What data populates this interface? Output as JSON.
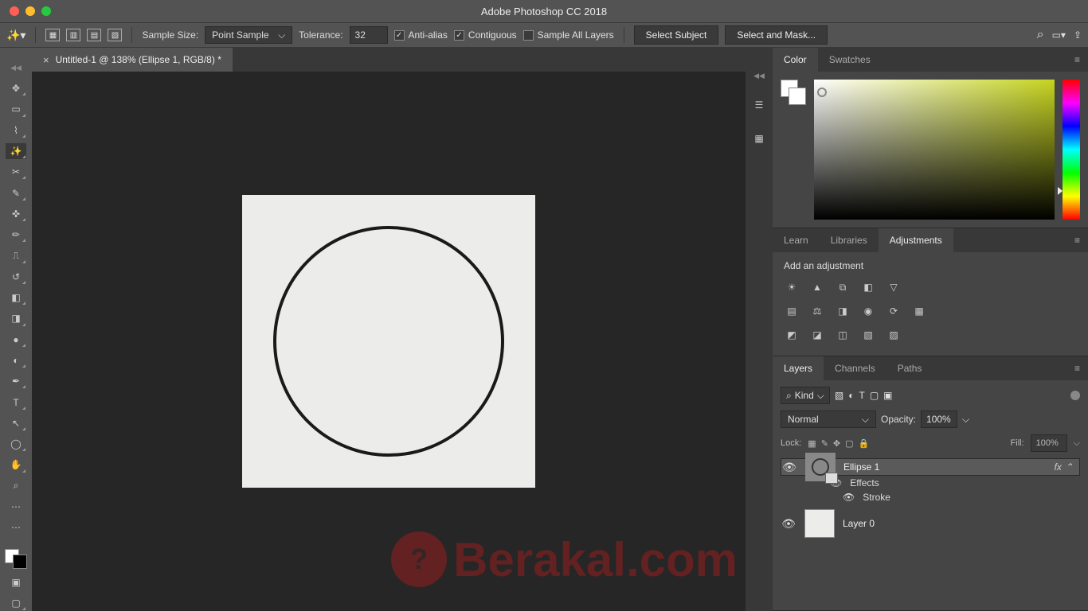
{
  "titlebar": {
    "title": "Adobe Photoshop CC 2018"
  },
  "options": {
    "sample_label": "Sample Size:",
    "sample_value": "Point Sample",
    "tolerance_label": "Tolerance:",
    "tolerance_value": "32",
    "antialias": "Anti-alias",
    "contiguous": "Contiguous",
    "sample_all": "Sample All Layers",
    "select_subject": "Select Subject",
    "select_mask": "Select and Mask..."
  },
  "doc_tab": "Untitled-1 @ 138% (Ellipse 1, RGB/8) *",
  "watermark": "Berakal.com",
  "panels": {
    "color": {
      "tab1": "Color",
      "tab2": "Swatches"
    },
    "adjust": {
      "tab1": "Learn",
      "tab2": "Libraries",
      "tab3": "Adjustments",
      "header": "Add an adjustment"
    },
    "layers": {
      "tab1": "Layers",
      "tab2": "Channels",
      "tab3": "Paths",
      "kind": "Kind",
      "blend": "Normal",
      "opacity_label": "Opacity:",
      "opacity_val": "100%",
      "lock_label": "Lock:",
      "fill_label": "Fill:",
      "fill_val": "100%",
      "items": [
        {
          "name": "Ellipse 1",
          "fx": "fx",
          "effects": "Effects",
          "stroke": "Stroke"
        },
        {
          "name": "Layer 0"
        }
      ]
    }
  },
  "tools": [
    "move",
    "marquee",
    "lasso",
    "wand",
    "crop",
    "eyedrop",
    "heal",
    "brush",
    "stamp",
    "history",
    "eraser",
    "gradient",
    "blur",
    "dodge",
    "pen",
    "type",
    "path",
    "ellipse",
    "hand",
    "zoom",
    "more",
    "edit"
  ]
}
